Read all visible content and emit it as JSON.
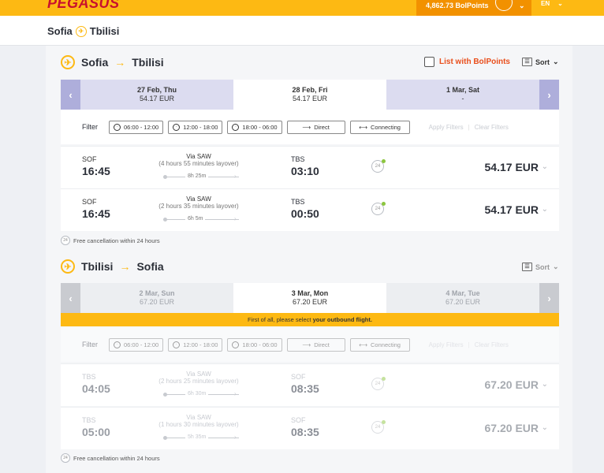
{
  "header": {
    "logo": "PEGASUS",
    "points": "4,862.73 BolPoints",
    "lang": "EN"
  },
  "route": {
    "from": "Sofia",
    "to": "Tbilisi"
  },
  "outbound": {
    "from": "Sofia",
    "to": "Tbilisi",
    "list_bolpoints": "List with BolPoints",
    "sort": "Sort",
    "dates": [
      {
        "day": "27 Feb, Thu",
        "price": "54.17 EUR"
      },
      {
        "day": "28 Feb, Fri",
        "price": "54.17 EUR"
      },
      {
        "day": "1 Mar, Sat",
        "price": "-"
      }
    ],
    "filter": {
      "label": "Filter",
      "t1": "06:00 - 12:00",
      "t2": "12:00 - 18:00",
      "t3": "18:00 - 06:00",
      "direct": "Direct",
      "connecting": "Connecting",
      "apply": "Apply Filters",
      "clear": "Clear Filters"
    },
    "flights": [
      {
        "dep_code": "SOF",
        "dep_time": "16:45",
        "via": "Via SAW",
        "layover": "(4 hours 55 minutes layover)",
        "duration": "8h 25m",
        "arr_code": "TBS",
        "arr_time": "03:10",
        "price": "54.17 EUR"
      },
      {
        "dep_code": "SOF",
        "dep_time": "16:45",
        "via": "Via SAW",
        "layover": "(2 hours 35 minutes layover)",
        "duration": "6h 5m",
        "arr_code": "TBS",
        "arr_time": "00:50",
        "price": "54.17 EUR"
      }
    ],
    "note": "Free cancellation within 24 hours"
  },
  "return": {
    "from": "Tbilisi",
    "to": "Sofia",
    "sort": "Sort",
    "dates": [
      {
        "day": "2 Mar, Sun",
        "price": "67.20 EUR"
      },
      {
        "day": "3 Mar, Mon",
        "price": "67.20 EUR"
      },
      {
        "day": "4 Mar, Tue",
        "price": "67.20 EUR"
      }
    ],
    "warning_pre": "First of all, please select ",
    "warning_bold": "your outbound flight.",
    "filter": {
      "label": "Filter",
      "t1": "06:00 - 12:00",
      "t2": "12:00 - 18:00",
      "t3": "18:00 - 06:00",
      "direct": "Direct",
      "connecting": "Connecting",
      "apply": "Apply Filters",
      "clear": "Clear Filters"
    },
    "flights": [
      {
        "dep_code": "TBS",
        "dep_time": "04:05",
        "via": "Via SAW",
        "layover": "(2 hours 25 minutes layover)",
        "duration": "6h 30m",
        "arr_code": "SOF",
        "arr_time": "08:35",
        "price": "67.20 EUR"
      },
      {
        "dep_code": "TBS",
        "dep_time": "05:00",
        "via": "Via SAW",
        "layover": "(1 hours 30 minutes layover)",
        "duration": "5h 35m",
        "arr_code": "SOF",
        "arr_time": "08:35",
        "price": "67.20 EUR"
      }
    ],
    "note": "Free cancellation within 24 hours"
  },
  "badge_24": "24"
}
